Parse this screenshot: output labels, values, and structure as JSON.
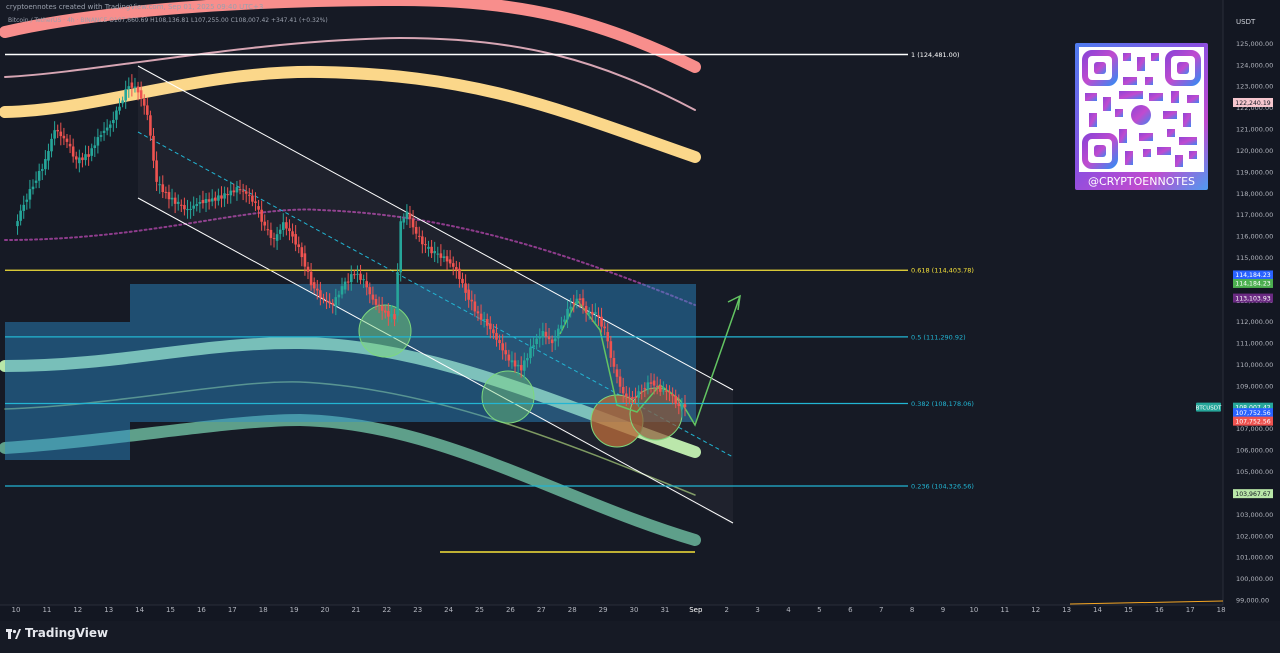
{
  "header": {
    "created_by": "cryptoennotes created with TradingView.com, Sep 01, 2025 09:40 UTC+3",
    "symbol": "Bitcoin / TetherUS · 4h · BINANCE",
    "ohlc": "O107,660.69 H108,136.81 L107,255.00 C108,007.42 +347.41 (+0.32%)"
  },
  "brand": {
    "name": "TradingView"
  },
  "watermark": {
    "handle": "@CRYPTOENNOTES"
  },
  "colors": {
    "background": "#161a25",
    "up": "#26a69a",
    "down": "#ef5350",
    "fib": "#22b5d3",
    "yellow": "#f5e13a"
  },
  "chart_data": {
    "type": "candlestick",
    "interval": "4h",
    "y_axis_unit": "USDT",
    "ylim": [
      99000,
      126500
    ],
    "y_ticks": [
      "126,000.00",
      "125,000.00",
      "124,000.00",
      "123,000.00",
      "122,000.00",
      "121,000.00",
      "120,000.00",
      "119,000.00",
      "118,000.00",
      "117,000.00",
      "116,000.00",
      "115,000.00",
      "114,000.00",
      "113,000.00",
      "112,000.00",
      "111,000.00",
      "110,000.00",
      "109,000.00",
      "108,000.00",
      "107,000.00",
      "106,000.00",
      "105,000.00",
      "104,000.00",
      "103,000.00",
      "102,000.00",
      "101,000.00",
      "100,000.00",
      "99,000.00"
    ],
    "x_ticks": [
      "10",
      "11",
      "12",
      "13",
      "14",
      "15",
      "16",
      "17",
      "18",
      "19",
      "20",
      "21",
      "22",
      "23",
      "24",
      "25",
      "26",
      "27",
      "28",
      "29",
      "30",
      "31",
      "Sep",
      "2",
      "3",
      "4",
      "5",
      "6",
      "7",
      "8",
      "9",
      "10",
      "11",
      "12",
      "13",
      "14",
      "15",
      "16",
      "17",
      "18"
    ],
    "fib_levels": [
      {
        "label": "1 (124,481.00)",
        "price": 124481.0
      },
      {
        "label": "0.618 (114,403.78)",
        "price": 114403.78
      },
      {
        "label": "0.5 (111,290.92)",
        "price": 111290.92
      },
      {
        "label": "0.382 (108,178.06)",
        "price": 108178.06
      },
      {
        "label": "0.236 (104,326.56)",
        "price": 104326.56
      }
    ],
    "price_labels": [
      {
        "text": "122,240.19",
        "price": 122240.19
      },
      {
        "text": "114,184.23",
        "price": 114184.23
      },
      {
        "text": "114,184.23",
        "price": 114184.23
      },
      {
        "text": "113,103.93",
        "price": 113103.93
      },
      {
        "text": "BTCUSDT",
        "price": 108007.42
      },
      {
        "text": "108,007.42",
        "price": 108007.42
      },
      {
        "text": "01:19:50",
        "price": 108007.42
      },
      {
        "text": "107,752.56",
        "price": 107752.56
      },
      {
        "text": "107,752.56",
        "price": 107752.56
      },
      {
        "text": "103,967.67",
        "price": 103967.67
      }
    ],
    "close_path": [
      [
        10.0,
        116.4
      ],
      [
        10.3,
        117.5
      ],
      [
        10.6,
        118.4
      ],
      [
        11.0,
        119.5
      ],
      [
        11.3,
        121.0
      ],
      [
        11.7,
        120.4
      ],
      [
        12.0,
        119.5
      ],
      [
        12.4,
        119.8
      ],
      [
        12.8,
        120.8
      ],
      [
        13.1,
        121.2
      ],
      [
        13.4,
        122.1
      ],
      [
        13.7,
        123.1
      ],
      [
        14.0,
        122.8
      ],
      [
        14.3,
        121.7
      ],
      [
        14.6,
        118.5
      ],
      [
        15.0,
        117.8
      ],
      [
        15.3,
        117.5
      ],
      [
        15.6,
        117.2
      ],
      [
        16.0,
        117.6
      ],
      [
        16.4,
        117.7
      ],
      [
        16.8,
        117.9
      ],
      [
        17.2,
        118.2
      ],
      [
        17.5,
        118.0
      ],
      [
        17.8,
        117.5
      ],
      [
        18.1,
        116.4
      ],
      [
        18.4,
        115.8
      ],
      [
        18.7,
        116.6
      ],
      [
        19.0,
        116.0
      ],
      [
        19.3,
        115.1
      ],
      [
        19.6,
        113.8
      ],
      [
        20.0,
        113.0
      ],
      [
        20.3,
        112.8
      ],
      [
        20.6,
        113.6
      ],
      [
        21.0,
        114.3
      ],
      [
        21.3,
        113.9
      ],
      [
        21.6,
        113.0
      ],
      [
        22.0,
        112.4
      ],
      [
        22.3,
        112.2
      ],
      [
        22.5,
        116.6
      ],
      [
        22.7,
        117.1
      ],
      [
        23.0,
        116.1
      ],
      [
        23.3,
        115.5
      ],
      [
        23.6,
        115.2
      ],
      [
        24.0,
        114.9
      ],
      [
        24.3,
        114.4
      ],
      [
        24.6,
        113.4
      ],
      [
        25.0,
        112.3
      ],
      [
        25.3,
        111.9
      ],
      [
        25.6,
        111.2
      ],
      [
        26.0,
        110.2
      ],
      [
        26.4,
        109.8
      ],
      [
        26.8,
        111.0
      ],
      [
        27.1,
        111.5
      ],
      [
        27.4,
        111.0
      ],
      [
        27.7,
        111.9
      ],
      [
        28.0,
        112.8
      ],
      [
        28.3,
        113.1
      ],
      [
        28.5,
        112.4
      ],
      [
        28.8,
        112.4
      ],
      [
        29.1,
        111.6
      ],
      [
        29.4,
        109.8
      ],
      [
        29.7,
        108.6
      ],
      [
        30.0,
        108.4
      ],
      [
        30.3,
        108.8
      ],
      [
        30.6,
        109.2
      ],
      [
        30.9,
        108.8
      ],
      [
        31.2,
        108.7
      ],
      [
        31.5,
        108.0
      ],
      [
        31.7,
        108.1
      ]
    ]
  }
}
